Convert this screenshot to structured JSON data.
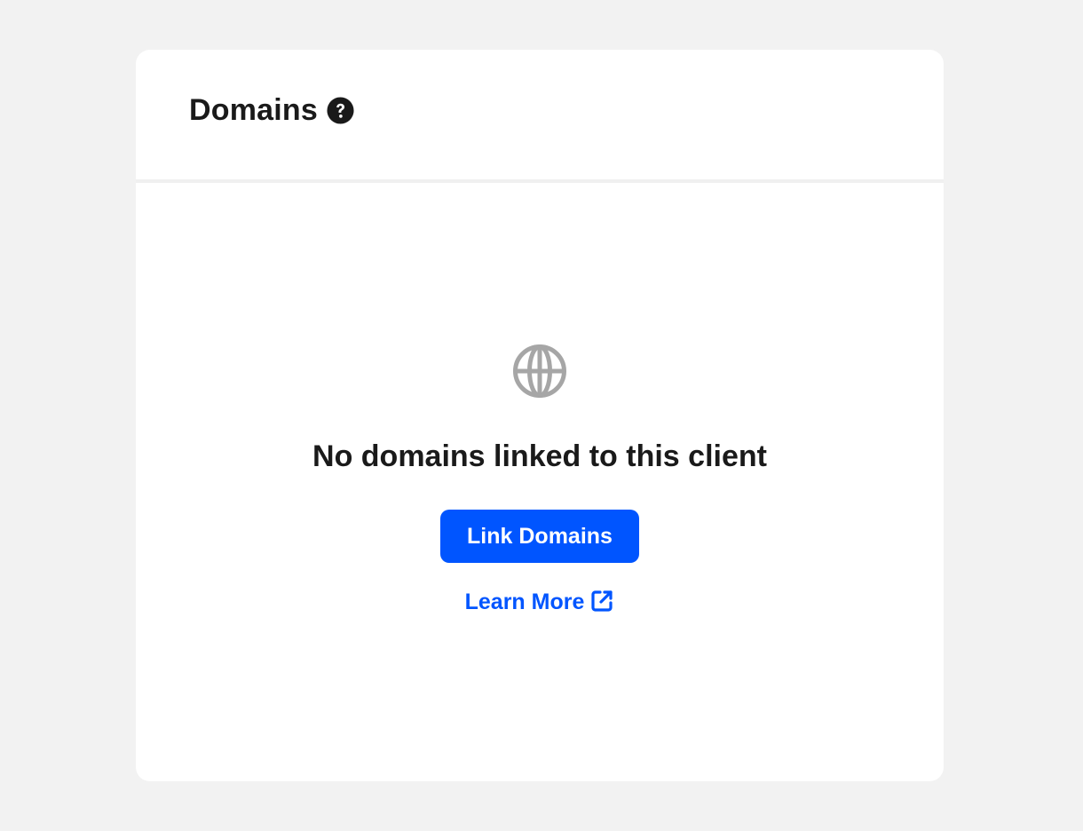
{
  "card": {
    "title": "Domains",
    "help_icon": "question-circle-icon"
  },
  "empty_state": {
    "icon": "globe-icon",
    "message": "No domains linked to this client",
    "primary_button_label": "Link Domains",
    "learn_more_label": "Learn More",
    "learn_more_icon": "external-link-icon"
  },
  "colors": {
    "background": "#f2f2f2",
    "card": "#ffffff",
    "accent": "#0055ff",
    "text": "#1a1a1a",
    "muted_icon": "#a6a6a6"
  }
}
